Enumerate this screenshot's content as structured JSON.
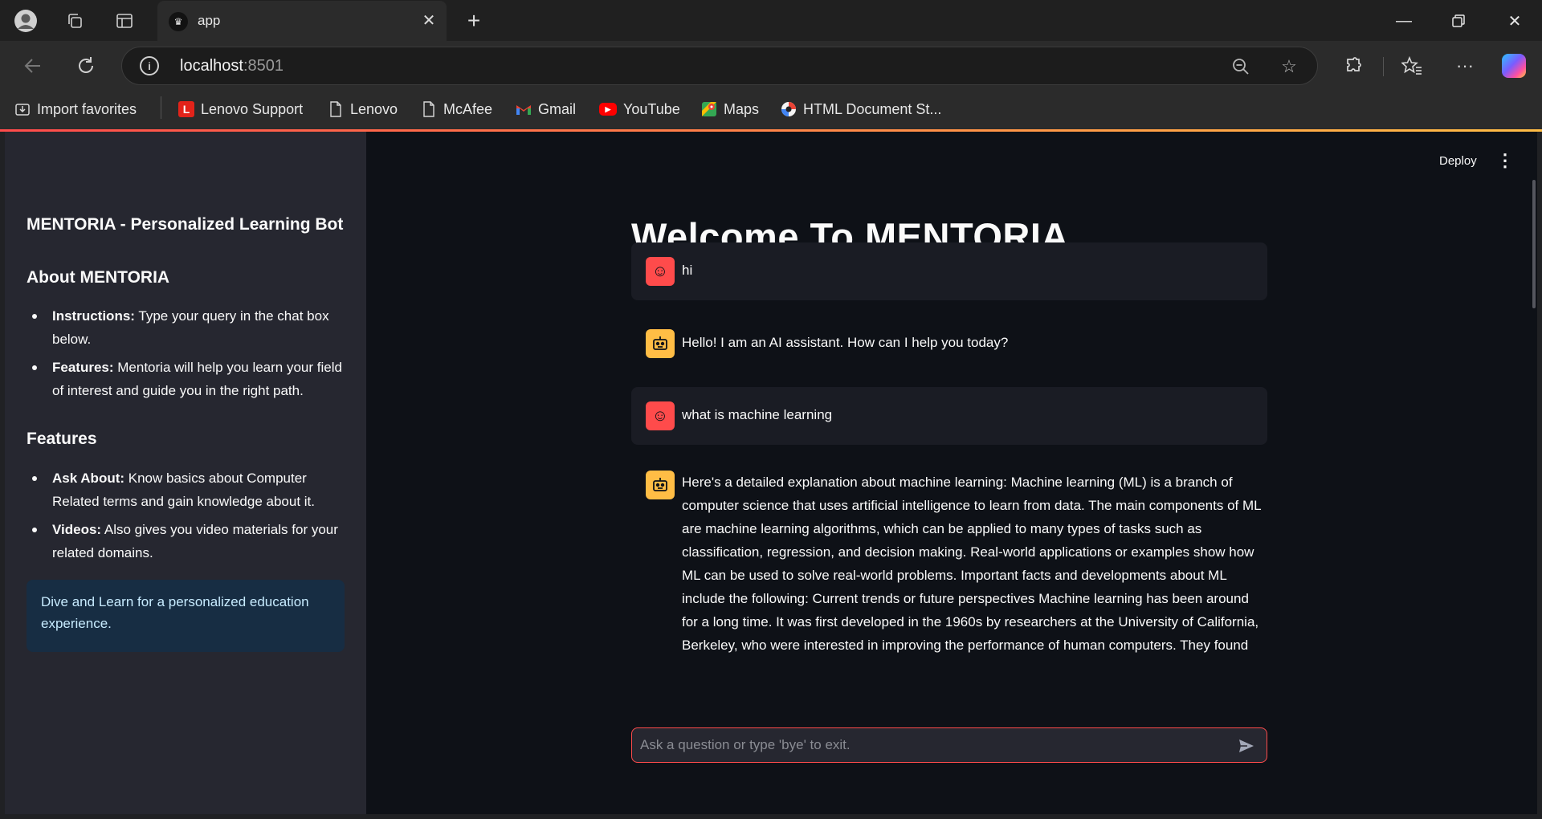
{
  "browser": {
    "tab_title": "app",
    "url_host": "localhost",
    "url_port": ":8501",
    "bookmarks": [
      {
        "label": "Import favorites",
        "icon": "import-icon"
      },
      {
        "label": "Lenovo Support",
        "icon": "lenovo-logo-icon",
        "color": "#e2231a"
      },
      {
        "label": "Lenovo",
        "icon": "page-icon"
      },
      {
        "label": "McAfee",
        "icon": "page-icon"
      },
      {
        "label": "Gmail",
        "icon": "gmail-icon"
      },
      {
        "label": "YouTube",
        "icon": "youtube-icon",
        "color": "#ff0000"
      },
      {
        "label": "Maps",
        "icon": "maps-icon"
      },
      {
        "label": "HTML Document St...",
        "icon": "document-icon"
      }
    ]
  },
  "sidebar": {
    "title": "MENTORIA - Personalized Learning Bot",
    "about_heading": "About MENTORIA",
    "about_items": [
      {
        "bold": "Instructions:",
        "text": " Type your query in the chat box below."
      },
      {
        "bold": "Features:",
        "text": " Mentoria will help you learn your field of interest and guide you in the right path."
      }
    ],
    "features_heading": "Features",
    "feature_items": [
      {
        "bold": "Ask About:",
        "text": " Know basics about Computer Related terms and gain knowledge about it."
      },
      {
        "bold": "Videos:",
        "text": " Also gives you video materials for your related domains."
      }
    ],
    "info_box": "Dive and Learn for a personalized education experience."
  },
  "header": {
    "deploy_label": "Deploy",
    "menu_icon": "kebab-menu-icon"
  },
  "main": {
    "title": "Welcome To MENTORIA",
    "messages": [
      {
        "role": "user",
        "text": "hi"
      },
      {
        "role": "assistant",
        "text": "Hello! I am an AI assistant. How can I help you today?"
      },
      {
        "role": "user",
        "text": "what is machine learning"
      },
      {
        "role": "assistant",
        "text": "Here's a detailed explanation about machine learning: Machine learning (ML) is a branch of computer science that uses artificial intelligence to learn from data. The main components of ML are machine learning algorithms, which can be applied to many types of tasks such as classification, regression, and decision making. Real-world applications or examples show how ML can be used to solve real-world problems. Important facts and developments about ML include the following: Current trends or future perspectives Machine learning has been around for a long time. It was first developed in the 1960s by researchers at the University of California, Berkeley, who were interested in improving the performance of human computers. They found"
      }
    ],
    "chat_placeholder": "Ask a question or type 'bye' to exit."
  },
  "colors": {
    "accent": "#ff4b4b",
    "bot_avatar": "#ffbd45",
    "info_bg": "#172d43",
    "app_bg": "#0e1117",
    "sidebar_bg": "#262730"
  }
}
